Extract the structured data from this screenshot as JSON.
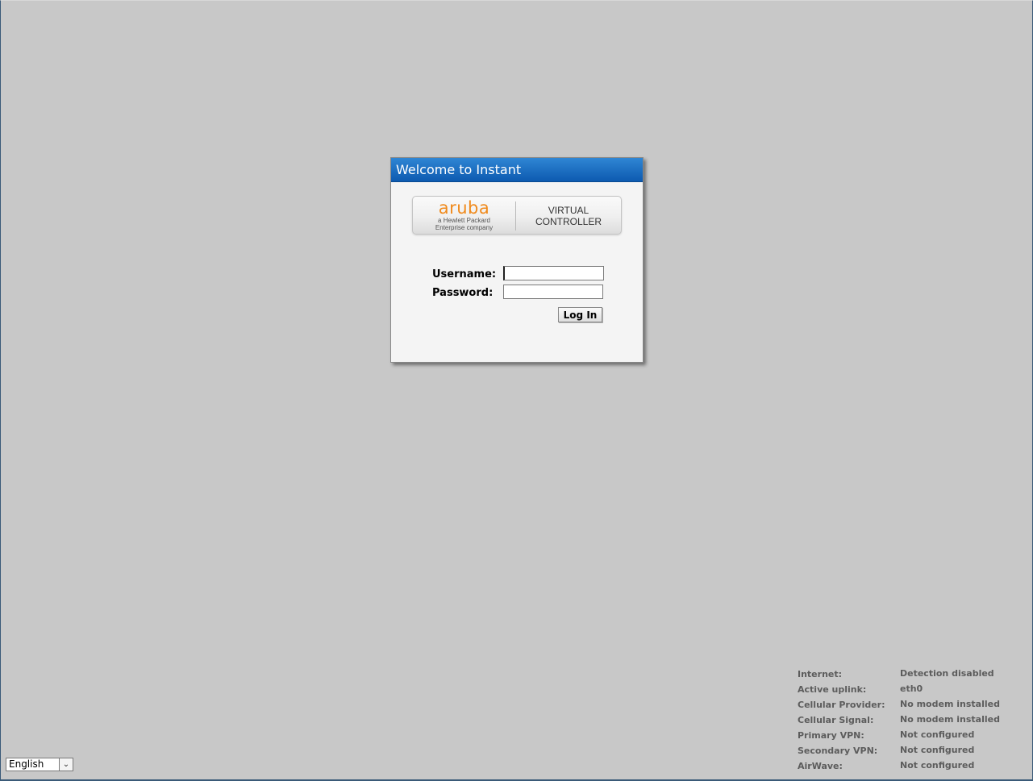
{
  "dialog": {
    "title": "Welcome to Instant",
    "logo": {
      "brand": "aruba",
      "tagline_line1": "a Hewlett Packard",
      "tagline_line2": "Enterprise company",
      "product_line1": "VIRTUAL",
      "product_line2": "CONTROLLER"
    },
    "form": {
      "username_label": "Username:",
      "username_value": "",
      "password_label": "Password:",
      "password_value": "",
      "submit_label": "Log In"
    }
  },
  "status": [
    {
      "key": "Internet:",
      "value": "Detection disabled"
    },
    {
      "key": "Active uplink:",
      "value": "eth0"
    },
    {
      "key": "Cellular Provider:",
      "value": "No modem installed"
    },
    {
      "key": "Cellular Signal:",
      "value": "No modem installed"
    },
    {
      "key": "Primary VPN:",
      "value": "Not configured"
    },
    {
      "key": "Secondary VPN:",
      "value": "Not configured"
    },
    {
      "key": "AirWave:",
      "value": "Not configured"
    }
  ],
  "language": {
    "selected": "English"
  },
  "colors": {
    "background": "#c8c8c8",
    "title_bar": "#1a6cc4",
    "brand_orange": "#f08a1c"
  }
}
